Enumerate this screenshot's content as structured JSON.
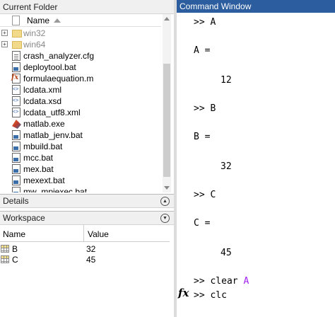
{
  "current_folder": {
    "title": "Current Folder",
    "column_name": "Name",
    "items": [
      {
        "name": "win32",
        "type": "folder",
        "expandable": true
      },
      {
        "name": "win64",
        "type": "folder",
        "expandable": true
      },
      {
        "name": "crash_analyzer.cfg",
        "type": "doc"
      },
      {
        "name": "deploytool.bat",
        "type": "bat"
      },
      {
        "name": "formulaequation.m",
        "type": "mfile"
      },
      {
        "name": "lcdata.xml",
        "type": "xml"
      },
      {
        "name": "lcdata.xsd",
        "type": "xml"
      },
      {
        "name": "lcdata_utf8.xml",
        "type": "xml"
      },
      {
        "name": "matlab.exe",
        "type": "exe"
      },
      {
        "name": "matlab_jenv.bat",
        "type": "bat"
      },
      {
        "name": "mbuild.bat",
        "type": "bat"
      },
      {
        "name": "mcc.bat",
        "type": "bat"
      },
      {
        "name": "mex.bat",
        "type": "bat"
      },
      {
        "name": "mexext.bat",
        "type": "bat"
      },
      {
        "name": "mw_mpiexec.bat",
        "type": "bat"
      }
    ]
  },
  "details": {
    "title": "Details"
  },
  "workspace": {
    "title": "Workspace",
    "col_name": "Name",
    "col_value": "Value",
    "rows": [
      {
        "name": "B",
        "value": "32"
      },
      {
        "name": "C",
        "value": "45"
      }
    ]
  },
  "command_window": {
    "title": "Command Window",
    "lines": [
      ">> A",
      "A =",
      "12",
      ">> B",
      "B =",
      "32",
      ">> C",
      "C =",
      "45"
    ],
    "clear_cmd": ">> clear",
    "clear_arg": "A",
    "last_cmd": ">> clc",
    "prompt_icon": "fx"
  }
}
